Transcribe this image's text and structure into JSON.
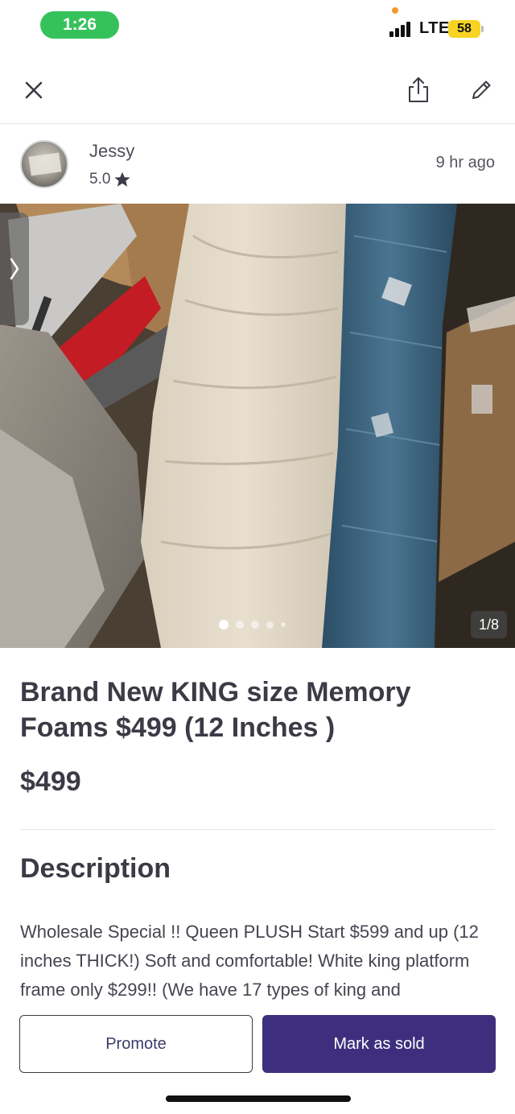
{
  "status_bar": {
    "time": "1:26",
    "network": "LTE",
    "battery": "58"
  },
  "nav": {
    "close_icon": "close-icon",
    "share_icon": "share-icon",
    "edit_icon": "pencil-icon"
  },
  "seller": {
    "name": "Jessy",
    "rating": "5.0",
    "posted": "9 hr ago"
  },
  "photo": {
    "counter": "1/8",
    "current_index": 1,
    "total": 8
  },
  "listing": {
    "title": "Brand New KING size Memory Foams $499 (12 Inches )",
    "price": "$499"
  },
  "description": {
    "heading": "Description",
    "text": "Wholesale Special !! Queen PLUSH Start $599 and up (12 inches THICK!) Soft and comfortable! White king platform frame only $299!! (We have 17 types of king and"
  },
  "actions": {
    "promote_label": "Promote",
    "mark_sold_label": "Mark as sold"
  },
  "colors": {
    "accent": "#3e2f7e",
    "time_pill": "#36c25b",
    "battery": "#f7d324"
  }
}
